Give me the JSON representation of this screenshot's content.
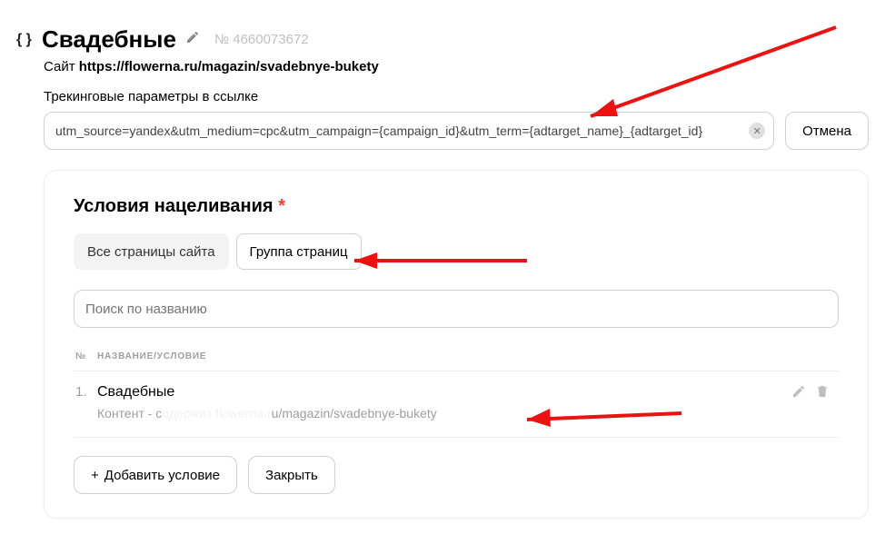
{
  "header": {
    "title": "Свадебные",
    "id_prefix": "№ ",
    "id": "4660073672",
    "site_prefix": "Сайт ",
    "site_url": "https://flowerna.ru/magazin/svadebnye-bukety"
  },
  "tracking": {
    "label": "Трекинговые параметры в ссылке",
    "value": "utm_source=yandex&utm_medium=cpc&utm_campaign={campaign_id}&utm_term={adtarget_name}_{adtarget_id}",
    "cancel": "Отмена"
  },
  "targeting": {
    "title": "Условия нацеливания",
    "tabs": {
      "all_pages": "Все страницы сайта",
      "page_group": "Группа страниц"
    },
    "search_placeholder": "Поиск по названию",
    "columns": {
      "num": "№",
      "name": "НАЗВАНИЕ/УСЛОВИЕ"
    },
    "rows": [
      {
        "num": "1.",
        "title": "Свадебные",
        "sub_prefix": "Контент - с",
        "sub_blurred": "одержит flowerna.r",
        "sub_suffix": "u/magazin/svadebnye-bukety"
      }
    ],
    "buttons": {
      "add": "Добавить условие",
      "close": "Закрыть"
    }
  }
}
